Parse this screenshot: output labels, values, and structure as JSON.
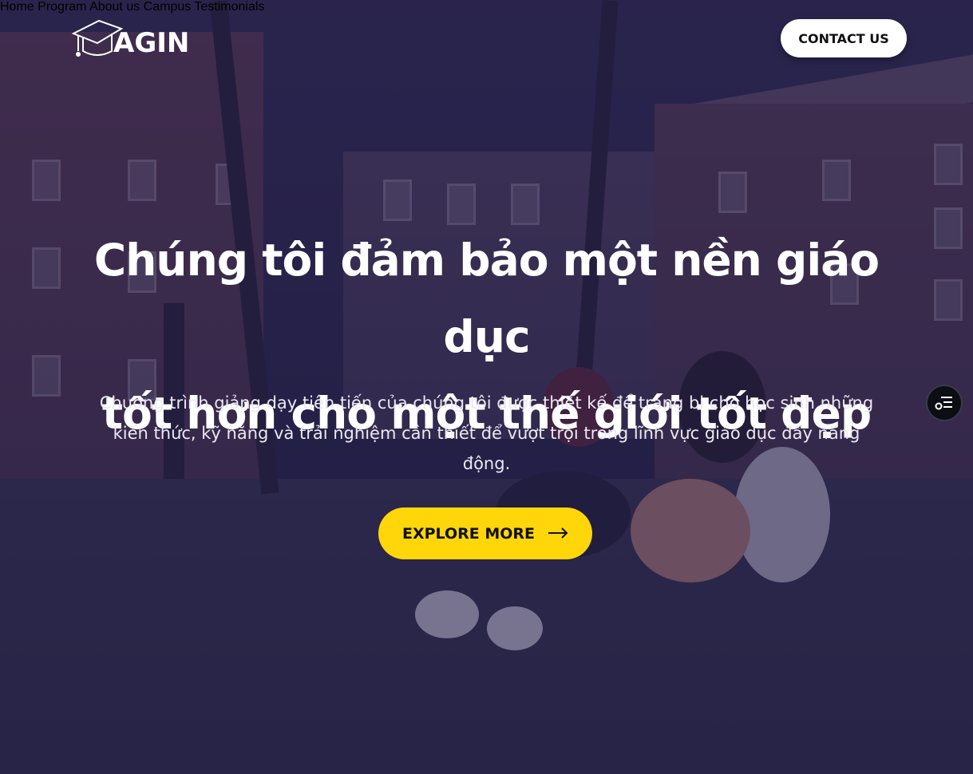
{
  "brand": {
    "name": "AGIN",
    "logo_icon": "graduation-cap-icon"
  },
  "nav": {
    "items": [
      {
        "label": "Home"
      },
      {
        "label": "Program"
      },
      {
        "label": "About us"
      },
      {
        "label": "Campus"
      },
      {
        "label": "Testimonials"
      }
    ],
    "cta_label": "CONTACT US"
  },
  "hero": {
    "headline_line1": "Chúng tôi đảm bảo một nền giáo dục",
    "headline_line2": "tốt hơn cho một thế giới tốt đẹp",
    "subtext_line1": "Chương trình giảng dạy tiên tiến của chúng tôi được thiết kế để trang bị cho học sinh những",
    "subtext_line2": "kiến thức, kỹ năng và trải nghiệm cần thiết để vượt trội trong lĩnh vực giáo dục đầy năng",
    "subtext_line3": "động.",
    "button_label": "EXPLORE MORE",
    "button_icon": "arrow-right-icon"
  },
  "side_widget": {
    "icon": "settings-list-icon"
  },
  "colors": {
    "overlay": "#1e1946",
    "accent": "#ffd60a",
    "text": "#ffffff"
  }
}
